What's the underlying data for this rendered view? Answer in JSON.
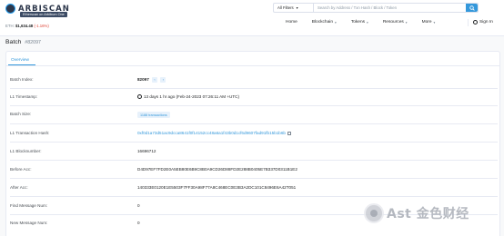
{
  "header": {
    "logo_text": "ARBISCAN",
    "network_badge": "Etherscan on Arbitrum One",
    "eth_label": "ETH:",
    "eth_price": "$1,634.48",
    "eth_change": "(-1.16%)",
    "filter_label": "All Filters",
    "search_placeholder": "Search by Address / Txn Hash / Block / Token",
    "nav": [
      "Home",
      "Blockchain",
      "Tokens",
      "Resources",
      "More"
    ],
    "signin": "Sign In"
  },
  "page": {
    "title": "Batch",
    "batch_number": "#82097",
    "tab": "Overview"
  },
  "rows": [
    {
      "label": "Batch Index:",
      "value": "82097"
    },
    {
      "label": "L1 Timestamp:",
      "value": "13 days 1 hr ago (Feb-24-2023 07:26:11 AM +UTC)"
    },
    {
      "label": "Batch Size:",
      "value": "1188 transactions"
    },
    {
      "label": "L1 Transaction Hash:",
      "value": "0xf0d1a73d51ac9dcca8641f0f14152cc48a6a1f43b0d1cf6d9607fad91fb15b1b6b"
    },
    {
      "label": "L1 Blocknumber:",
      "value": "16696712"
    },
    {
      "label": "Before Acc:",
      "value": "D4D97EF7FD2E0A5EB80E6B9C8B0A9CD26D88FD2E288B0405E7B337D0311B1E2"
    },
    {
      "label": "After Acc:",
      "value": "140333E0120E1E5503F7FF30A98F77A8C468EC0E3B3A2DC101C8496E6A42T051"
    },
    {
      "label": "Find Message Num:",
      "value": "0"
    },
    {
      "label": "New Message Num:",
      "value": "0"
    }
  ],
  "watermark": {
    "text": "Ast 金色财经"
  },
  "colors": {
    "accent": "#3498db",
    "negative": "#de4437",
    "text": "#1e2022",
    "muted": "#77838f"
  }
}
